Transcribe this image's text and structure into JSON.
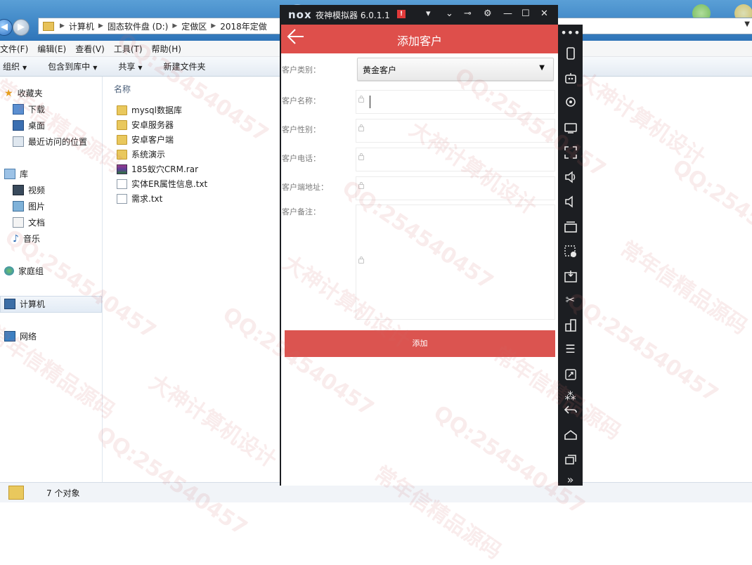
{
  "explorer": {
    "breadcrumb": [
      "计算机",
      "固态软件盘 (D:)",
      "定做区",
      "2018年定做"
    ],
    "menu": [
      "文件(F)",
      "编辑(E)",
      "查看(V)",
      "工具(T)",
      "帮助(H)"
    ],
    "toolbar": [
      {
        "label": "组织",
        "has_dropdown": true
      },
      {
        "label": "包含到库中",
        "has_dropdown": true
      },
      {
        "label": "共享",
        "has_dropdown": true
      },
      {
        "label": "新建文件夹",
        "has_dropdown": false
      }
    ],
    "nav": {
      "favorites": "收藏夹",
      "favorites_items": [
        "下载",
        "桌面",
        "最近访问的位置"
      ],
      "library": "库",
      "library_items": [
        "视频",
        "图片",
        "文档",
        "音乐"
      ],
      "homegroup": "家庭组",
      "computer": "计算机",
      "network": "网络"
    },
    "column_header": "名称",
    "files": [
      {
        "name": "mysql数据库",
        "type": "folder"
      },
      {
        "name": "安卓服务器",
        "type": "folder"
      },
      {
        "name": "安卓客户端",
        "type": "folder"
      },
      {
        "name": "系统演示",
        "type": "folder"
      },
      {
        "name": "185蚁穴CRM.rar",
        "type": "rar"
      },
      {
        "name": "实体ER属性信息.txt",
        "type": "txt"
      },
      {
        "name": "需求.txt",
        "type": "txt"
      }
    ],
    "status": "7 个对象"
  },
  "emulator": {
    "logo": "nox",
    "title": "夜神模拟器 6.0.1.1",
    "alert_icon": "!",
    "sidebar_icons": [
      "more-icon",
      "shake-icon",
      "robot-icon",
      "location-icon",
      "screen-icon",
      "fullscreen-icon",
      "volume-up-icon",
      "volume-down-icon",
      "toolbox-icon",
      "macro-icon",
      "apk-icon",
      "scissors-icon",
      "multi-window-icon",
      "menu-icon",
      "resize-icon",
      "loading-icon",
      "back-icon",
      "home-icon",
      "recent-icon",
      "expand-icon"
    ]
  },
  "app": {
    "title": "添加客户",
    "form": {
      "type_label": "客户类别：",
      "type_value": "黄金客户",
      "name_label": "客户名称：",
      "gender_label": "客户性别：",
      "phone_label": "客户电话：",
      "address_label": "客户端地址：",
      "notes_label": "客户备注："
    },
    "add_button": "添加"
  },
  "watermark": [
    "常年信精品源码",
    "QQ:254540457",
    "大神计算机设计"
  ],
  "colors": {
    "app_header": "#de4f4b",
    "add_button": "#db5450",
    "emulator_frame": "#1c1e22"
  }
}
